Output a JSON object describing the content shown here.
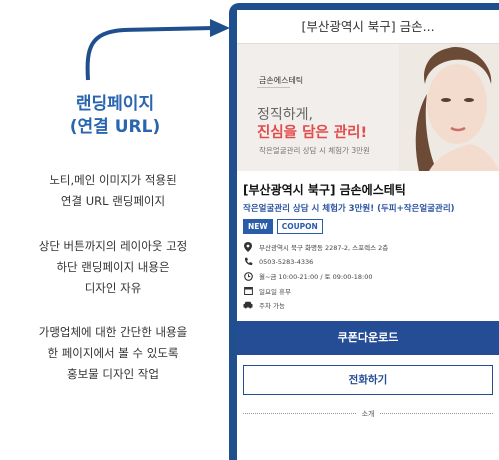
{
  "annotation": {
    "title_line1": "랜딩페이지",
    "title_line2": "(연결 URL)",
    "desc1": [
      "노티,메인 이미지가 적용된",
      "연결  URL 랜딩페이지"
    ],
    "desc2": [
      "상단 버튼까지의 레이아웃 고정",
      "하단 랜딩페이지 내용은",
      "디자인 자유"
    ],
    "desc3": [
      "가맹업체에 대한 간단한 내용을",
      "한 페이지에서 볼 수 있도록",
      "홍보물 디자인 작업"
    ]
  },
  "phone": {
    "topbar_title": "[부산광역시 북구] 금손...",
    "banner": {
      "brand": "금손에스테틱",
      "headline1": "정직하게,",
      "headline2": "진심을 담은 관리!",
      "subline": "작은얼굴관리 상담 시 체험가 3만원"
    },
    "shop_title": "[부산광역시 북구] 금손에스테틱",
    "shop_desc": "작은얼굴관리 상담 시 체험가 3만원! (두피+작은얼굴관리)",
    "badges": [
      "NEW",
      "COUPON"
    ],
    "info": [
      {
        "icon": "location-pin-icon",
        "text": "부산광역시 북구 화명동 2287-2, 스포렉스 2층"
      },
      {
        "icon": "phone-icon",
        "text": "0503-5283-4336"
      },
      {
        "icon": "clock-icon",
        "text": "월~금 10:00-21:00 / 토 09:00-18:00"
      },
      {
        "icon": "calendar-icon",
        "text": "일요일 휴무"
      },
      {
        "icon": "car-icon",
        "text": "주차 가능"
      }
    ],
    "coupon_button": "쿠폰다운로드",
    "call_button": "전화하기",
    "intro_label": "소개"
  },
  "colors": {
    "frame": "#1f4f8c",
    "accent": "#244d96",
    "headline_red": "#e24b4b",
    "annotation_blue": "#2a66b0"
  }
}
